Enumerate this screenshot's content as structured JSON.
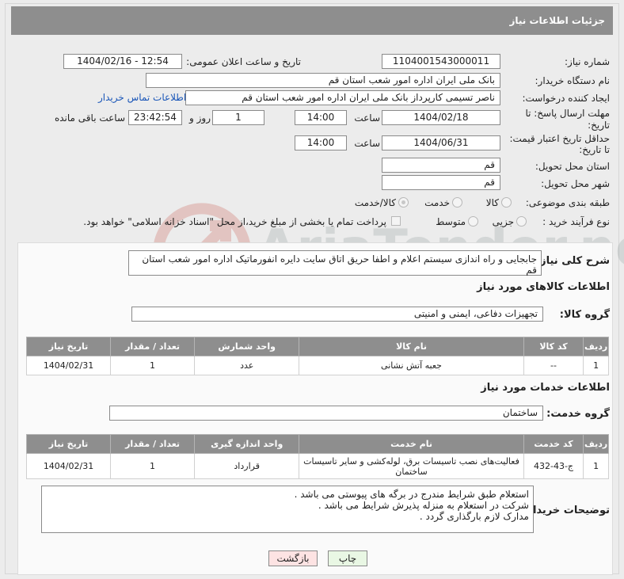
{
  "header": {
    "title": "جزئیات اطلاعات نیاز"
  },
  "form": {
    "need_number": {
      "label": "شماره نیاز:",
      "value": "1104001543000011"
    },
    "announce_datetime": {
      "label": "تاریخ و ساعت اعلان عمومی:",
      "value": "1404/02/16 - 12:54"
    },
    "buyer_org": {
      "label": "نام دستگاه خریدار:",
      "value": "بانک ملی ایران اداره امور شعب استان قم"
    },
    "requester": {
      "label": "ایجاد کننده درخواست:",
      "value": "ناصر  تسیمی  کارپرداز  بانک ملی ایران اداره امور شعب استان قم",
      "contact_link": "اطلاعات تماس خریدار"
    },
    "reply_deadline": {
      "label_line1": "مهلت ارسال پاسخ: تا",
      "label_line2": "تاریخ:",
      "date": "1404/02/18",
      "time_label": "ساعت",
      "time": "14:00",
      "days": "1",
      "days_label": "روز و",
      "remaining": "23:42:54",
      "remaining_label": "ساعت باقی مانده"
    },
    "price_validity": {
      "label_line1": "حداقل تاریخ اعتبار قیمت:",
      "label_line2": "تا تاریخ:",
      "date": "1404/06/31",
      "time_label": "ساعت",
      "time": "14:00"
    },
    "delivery_province": {
      "label": "استان محل تحویل:",
      "value": "قم"
    },
    "delivery_city": {
      "label": "شهر محل تحویل:",
      "value": "قم"
    },
    "category": {
      "label": "طبقه بندی موضوعی:",
      "options": [
        "کالا",
        "خدمت",
        "کالا/خدمت"
      ],
      "selected": "کالا/خدمت"
    },
    "process_type": {
      "label": "نوع فرآیند خرید :",
      "options": [
        "جزیی",
        "متوسط"
      ],
      "payment_note": "پرداخت تمام یا بخشی از مبلغ خرید،از محل \"اسناد خزانه اسلامی\" خواهد بود."
    }
  },
  "description": {
    "label": "شرح کلی نیاز:",
    "value": "جابجایی و راه اندازی سیستم اعلام و اطفا حریق اتاق سایت دایره انفورماتیک اداره امور شعب استان قم"
  },
  "goods": {
    "section_title": "اطلاعات کالاهای مورد نیاز",
    "group_label": "گروه کالا:",
    "group_value": "تجهیزات دفاعی، ایمنی و امنیتی",
    "columns": [
      "ردیف",
      "کد کالا",
      "نام کالا",
      "واحد شمارش",
      "تعداد / مقدار",
      "تاریخ نیاز"
    ],
    "rows": [
      {
        "row": "1",
        "code": "--",
        "name": "جعبه آتش نشانی",
        "unit": "عدد",
        "qty": "1",
        "date": "1404/02/31"
      }
    ]
  },
  "services": {
    "section_title": "اطلاعات خدمات مورد نیاز",
    "group_label": "گروه خدمت:",
    "group_value": "ساختمان",
    "columns": [
      "ردیف",
      "کد خدمت",
      "نام خدمت",
      "واحد اندازه گیری",
      "تعداد / مقدار",
      "تاریخ نیاز"
    ],
    "rows": [
      {
        "row": "1",
        "code": "ج-43-432",
        "name": "فعالیت‌های نصب تاسیسات برق، لوله‌کشی و سایر تاسیسات ساختمان",
        "unit": "قرارداد",
        "qty": "1",
        "date": "1404/02/31"
      }
    ]
  },
  "buyer_notes": {
    "label": "توضیحات خریدار:",
    "lines": [
      "استعلام طبق شرایط مندرج در برگه های پیوستی می باشد .",
      "شرکت در استعلام به منزله پذیرش شرایط می باشد .",
      "مدارک لازم بارگذاری گردد ."
    ]
  },
  "buttons": {
    "print": "چاپ",
    "back": "بازگشت"
  },
  "watermark": {
    "brand": "AriaTender.neT"
  },
  "colors": {
    "header_bg": "#8e8e8e",
    "link": "#1a56b8",
    "back_bg": "#fde3e3",
    "print_bg": "#e9f7e4"
  }
}
